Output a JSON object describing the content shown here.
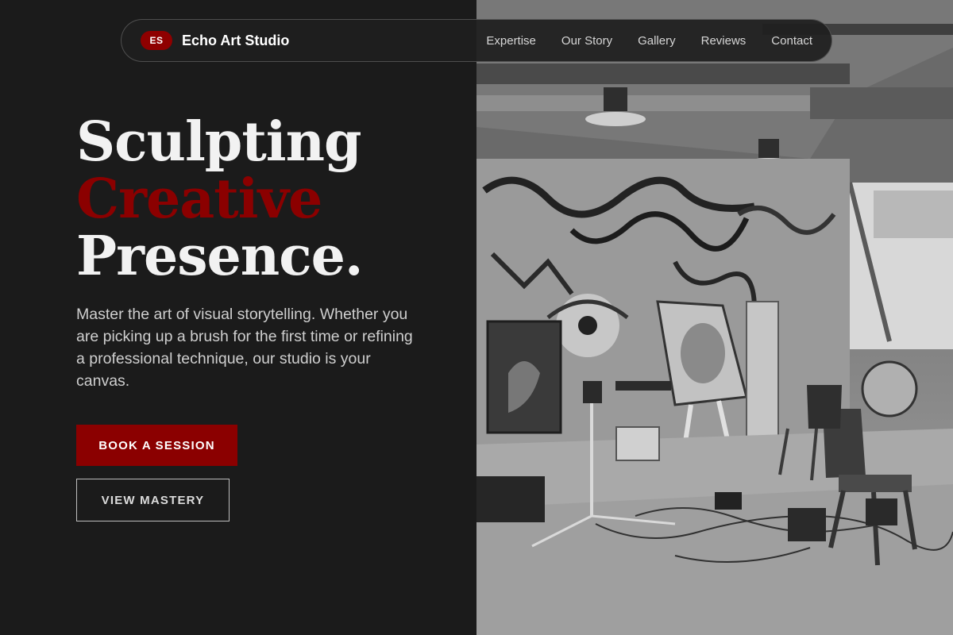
{
  "brand": {
    "badge": "ES",
    "name": "Echo Art Studio"
  },
  "nav": {
    "items": [
      {
        "label": "Expertise"
      },
      {
        "label": "Our Story"
      },
      {
        "label": "Gallery"
      },
      {
        "label": "Reviews"
      },
      {
        "label": "Contact"
      }
    ]
  },
  "hero": {
    "title_line1": "Sculpting",
    "title_line2": "Creative",
    "title_line3": "Presence.",
    "description": "Master the art of visual storytelling. Whether you are picking up a brush for the first time or refining a professional technique, our studio is your canvas.",
    "primary_button": "BOOK A SESSION",
    "secondary_button": "VIEW MASTERY"
  },
  "colors": {
    "background": "#1b1b1b",
    "accent": "#8b0000",
    "text": "#f2f2f2"
  },
  "image": {
    "subject": "black-and-white art studio interior with graffiti walls, easels and chairs"
  }
}
